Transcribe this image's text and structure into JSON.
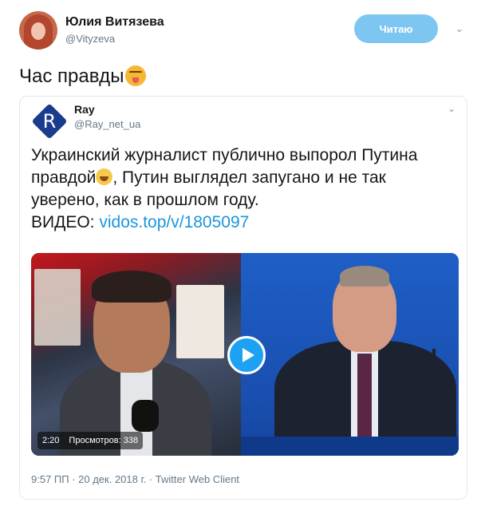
{
  "author": {
    "name": "Юлия Витязева",
    "handle": "@Vityzeva",
    "follow_label": "Читаю",
    "caret": "⌄"
  },
  "tweet": {
    "text": "Час правды"
  },
  "quoted": {
    "avatar_letter": "R",
    "name": "Ray",
    "handle": "@Ray_net_ua",
    "caret": "⌄",
    "line1": "Украинский журналист публично выпорол Путина",
    "line2_a": "правдой",
    "line2_b": ", Путин выглядел запугано и не так",
    "line3": "уверено, как в прошлом году.",
    "video_label": "ВИДЕО: ",
    "video_link": "vidos.top/v/1805097",
    "video": {
      "duration": "2:20",
      "views": "Просмотров: 338"
    },
    "timestamp": "9:57 ПП · 20 дек. 2018 г. · Twitter Web Client"
  },
  "colors": {
    "link": "#1b95e0",
    "follow_button": "#7dc6f1",
    "play_button": "#1da1f2",
    "brand_avatar": "#1b3c8c"
  }
}
